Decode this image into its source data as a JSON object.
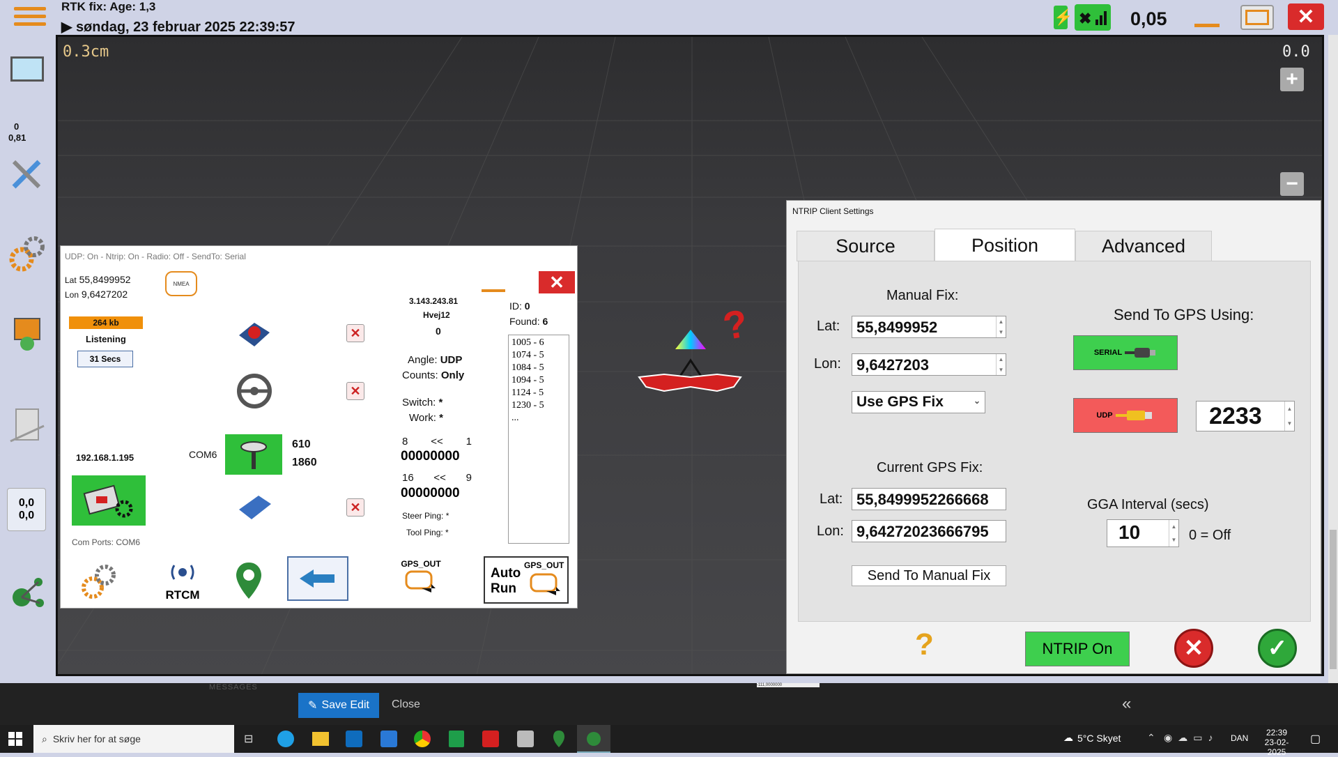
{
  "top": {
    "rtk_fix": "RTK fix: Age: 1,3",
    "datetime": "søndag, 23 februar 2025 22:39:57",
    "speed": "0,05",
    "colors": {
      "bar_bg": "#cfd3e6",
      "accent_orange": "#e58b1d",
      "close_red": "#d92b2b",
      "signal_green": "#2fbf3a"
    }
  },
  "left": {
    "v1": "0",
    "v2": "0,81",
    "xy1": "0,0",
    "xy2": "0,0"
  },
  "viewport": {
    "scale": "0.3cm",
    "zoom": "0.0",
    "zoom_in": "+",
    "zoom_out": "−",
    "question": "?"
  },
  "udp": {
    "title": "UDP: On - Ntrip: On - Radio: Off - SendTo: Serial",
    "lat_label": "Lat",
    "lat": "55,8499952",
    "lon_label": "Lon",
    "lon": "9,6427202",
    "kb": "264 kb",
    "listening": "Listening",
    "secs": "31 Secs",
    "ip": "192.168.1.195",
    "com6": "COM6",
    "com_ports": "Com Ports:  COM6",
    "gps_610": "610",
    "gps_1860": "1860",
    "net_ip": "3.143.243.81",
    "net_name": "Hvej12",
    "net_count": "0",
    "angle_label": "Angle:",
    "angle_val": "UDP",
    "counts_label": "Counts:",
    "counts_val": "Only",
    "switch_label": "Switch:",
    "switch_val": "*",
    "work_label": "Work:",
    "work_val": "*",
    "row1_left": "8",
    "row1_arrow": "<<",
    "row1_right": "1",
    "row1_bits": "00000000",
    "row2_left": "16",
    "row2_arrow": "<<",
    "row2_right": "9",
    "row2_bits": "00000000",
    "steer_ping": "Steer Ping:  *",
    "tool_ping": "Tool Ping:  *",
    "id_label": "ID:",
    "id_val": "0",
    "found_label": "Found:",
    "found_val": "6",
    "messages": [
      "1005 - 6",
      "1074 - 5",
      "1084 - 5",
      "1094 - 5",
      "1124 - 5",
      "1230 - 5",
      "..."
    ],
    "rtcm": "RTCM",
    "gps_out": "GPS_OUT",
    "auto_run_1": "Auto",
    "auto_run_2": "Run",
    "gps_out_2": "GPS_OUT",
    "close": "✕"
  },
  "ntrip": {
    "title": "NTRIP Client Settings",
    "tabs": [
      "Source",
      "Position",
      "Advanced"
    ],
    "manual_fix": "Manual Fix:",
    "lat_label": "Lat:",
    "manual_lat": "55,8499952",
    "lon_label": "Lon:",
    "manual_lon": "9,6427203",
    "use_gps_fix": "Use GPS Fix",
    "current_gps_fix": "Current GPS Fix:",
    "cur_lat": "55,8499952266668",
    "cur_lon": "9,64272023666795",
    "send_manual": "Send To Manual Fix",
    "send_to_gps": "Send To GPS Using:",
    "serial": "SERIAL",
    "udp": "UDP",
    "port": "2233",
    "gga_interval": "GGA Interval (secs)",
    "gga_val": "10",
    "gga_off": "0 = Off",
    "help": "?",
    "ntrip_on": "NTRIP On"
  },
  "bottom": {
    "messages": "MESSAGES",
    "save_edit": "Save Edit",
    "close": "Close",
    "collapse": "«",
    "coord_snip": "-111,0000000"
  },
  "taskbar": {
    "search_placeholder": "Skriv her for at søge",
    "weather": "5°C  Skyet",
    "lang": "DAN",
    "time": "22:39",
    "date": "23-02-2025"
  }
}
